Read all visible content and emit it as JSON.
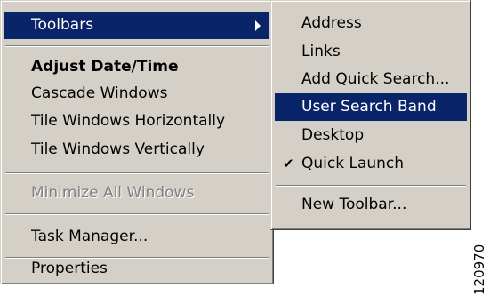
{
  "main_menu": {
    "toolbars": "Toolbars",
    "adjust_datetime": "Adjust Date/Time",
    "cascade": "Cascade Windows",
    "tile_horizontal": "Tile Windows Horizontally",
    "tile_vertical": "Tile Windows Vertically",
    "minimize_all": "Minimize All Windows",
    "task_manager": "Task Manager...",
    "properties": "Properties"
  },
  "toolbars_submenu": {
    "address": "Address",
    "links": "Links",
    "add_quick_search": "Add Quick Search...",
    "user_search_band": "User Search Band",
    "desktop": "Desktop",
    "quick_launch": "Quick Launch",
    "quick_launch_check": "✔",
    "new_toolbar": "New Toolbar..."
  },
  "figure_number": "120970",
  "colors": {
    "menu_face": "#d4d0c8",
    "highlight": "#0a246a",
    "disabled_text": "#808080"
  }
}
